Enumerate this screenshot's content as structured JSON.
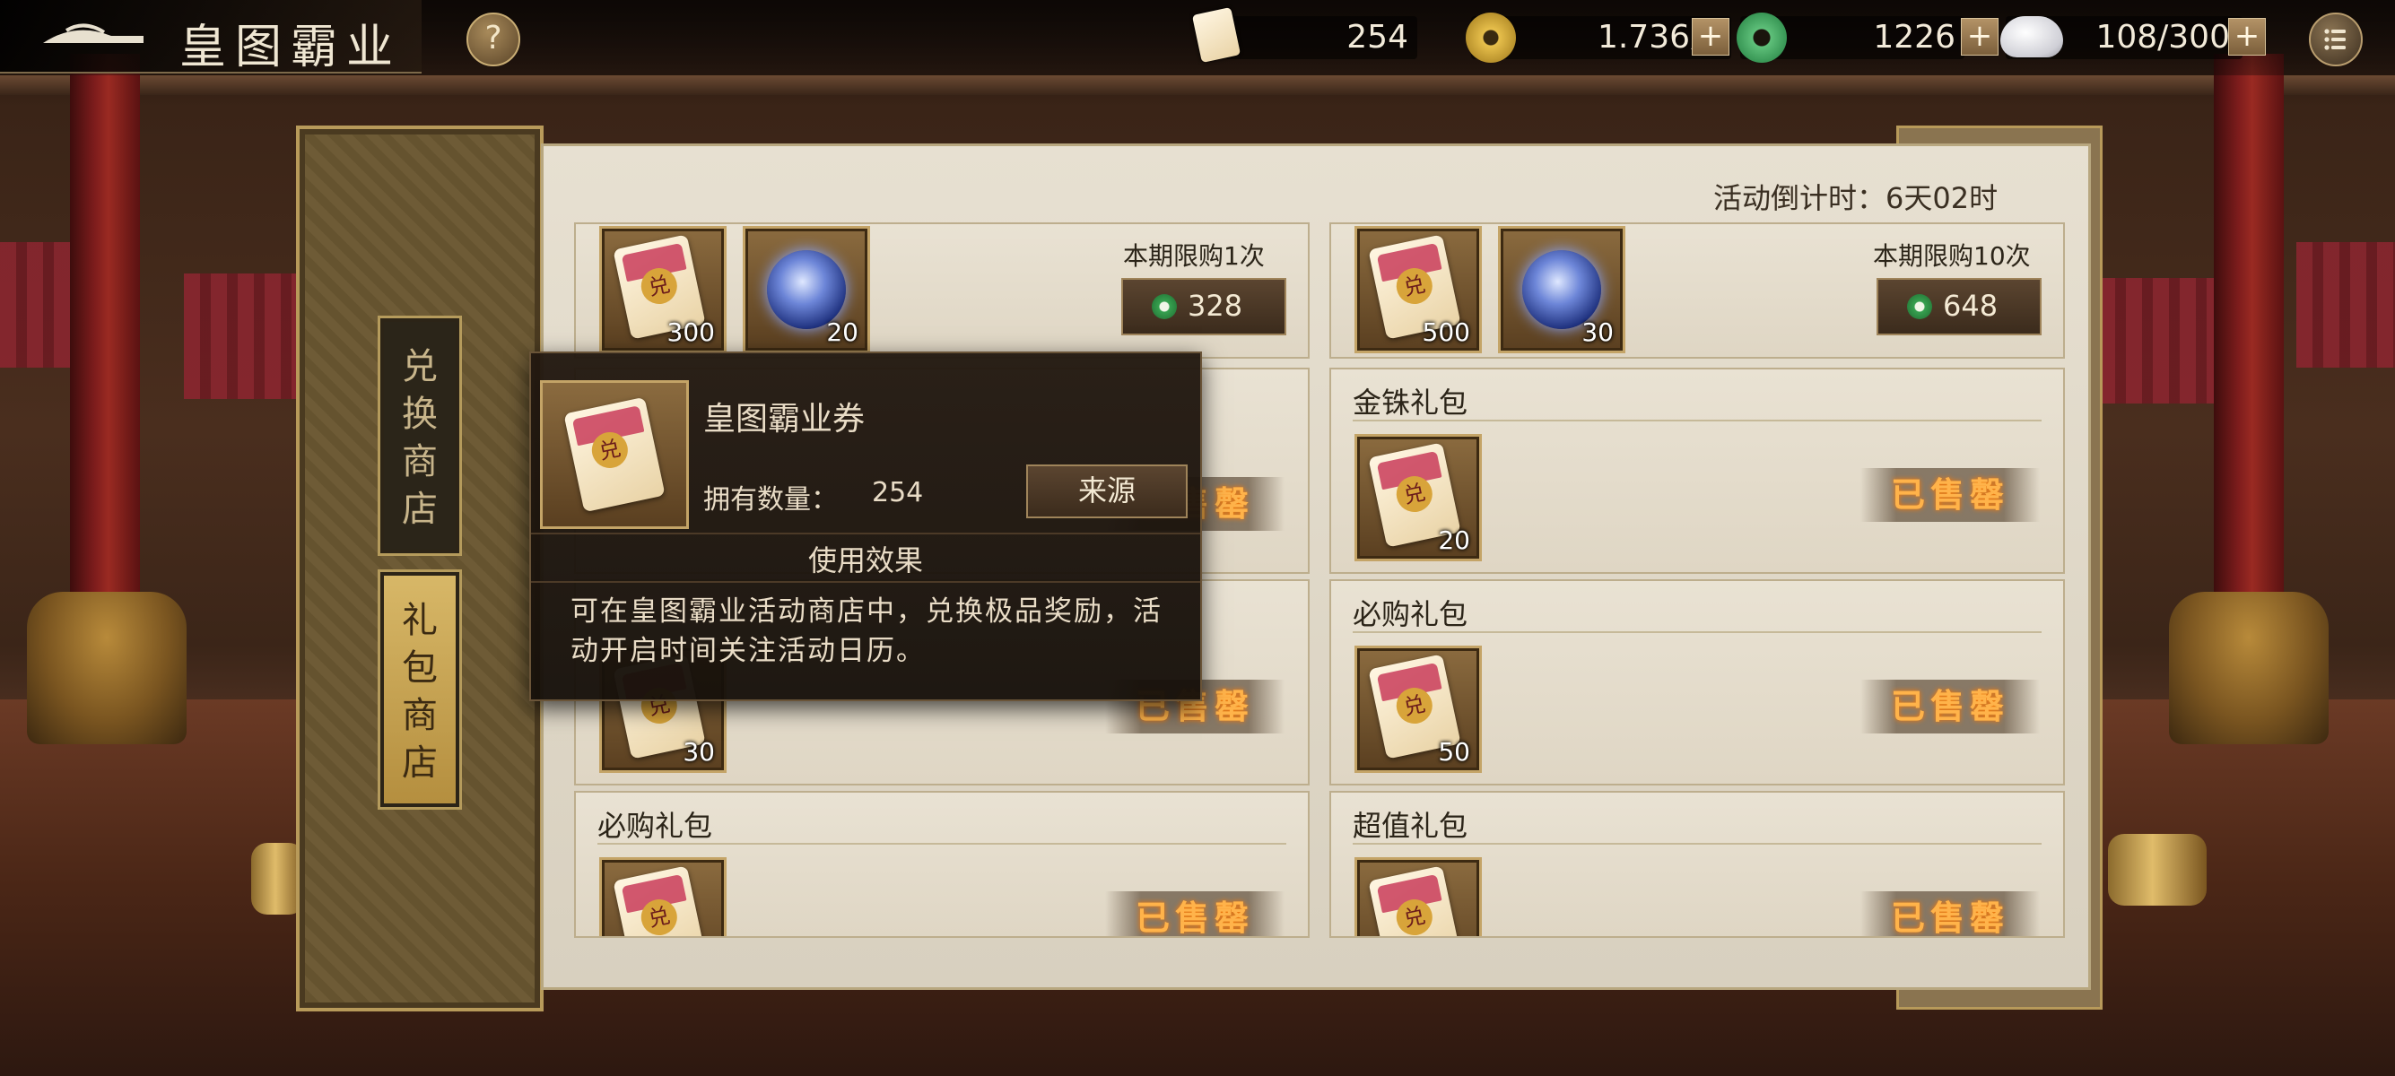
{
  "header": {
    "title": "皇图霸业",
    "help_label": "?",
    "resources": [
      {
        "name": "ticket",
        "value": "254"
      },
      {
        "name": "copper-coin",
        "value": "1.736万"
      },
      {
        "name": "jade-coin",
        "value": "1226"
      },
      {
        "name": "stamina",
        "value": "108/300"
      }
    ],
    "plus_label": "+"
  },
  "sidebar": {
    "tabs": [
      {
        "label": "兑换商店",
        "chars": [
          "兑",
          "换",
          "商",
          "店"
        ],
        "active": false
      },
      {
        "label": "礼包商店",
        "chars": [
          "礼",
          "包",
          "商",
          "店"
        ],
        "active": true
      }
    ]
  },
  "main": {
    "countdown": "活动倒计时：6天02时",
    "cards": [
      {
        "title": "",
        "items": [
          {
            "type": "ticket",
            "qty": "300"
          },
          {
            "type": "orb",
            "qty": "20"
          }
        ],
        "limit": "本期限购1次",
        "price": "328"
      },
      {
        "title": "",
        "items": [
          {
            "type": "ticket",
            "qty": "500"
          },
          {
            "type": "orb",
            "qty": "30"
          }
        ],
        "limit": "本期限购10次",
        "price": "648"
      },
      {
        "title": "",
        "items": [],
        "status": "已售罄"
      },
      {
        "title": "金铢礼包",
        "items": [
          {
            "type": "ticket",
            "qty": "20"
          }
        ],
        "status": "已售罄"
      },
      {
        "title": "",
        "items": [
          {
            "type": "ticket",
            "qty": "30"
          }
        ],
        "status": "已售罄"
      },
      {
        "title": "必购礼包",
        "items": [
          {
            "type": "ticket",
            "qty": "50"
          }
        ],
        "status": "已售罄"
      },
      {
        "title": "必购礼包",
        "items": [
          {
            "type": "ticket",
            "qty": ""
          }
        ],
        "status": "已售罄"
      },
      {
        "title": "超值礼包",
        "items": [
          {
            "type": "ticket",
            "qty": ""
          }
        ],
        "status": "已售罄"
      }
    ]
  },
  "tooltip": {
    "item_name": "皇图霸业券",
    "owned_label": "拥有数量：",
    "owned_value": "254",
    "source_button": "来源",
    "effect_title": "使用效果",
    "description": "可在皇图霸业活动商店中，兑换极品奖励，活动开启时间关注活动日历。",
    "ticket_glyph": "兑"
  },
  "colors": {
    "sold_out": "#ffb34a",
    "tab_active": "#d8b868",
    "jade": "#37a150"
  }
}
